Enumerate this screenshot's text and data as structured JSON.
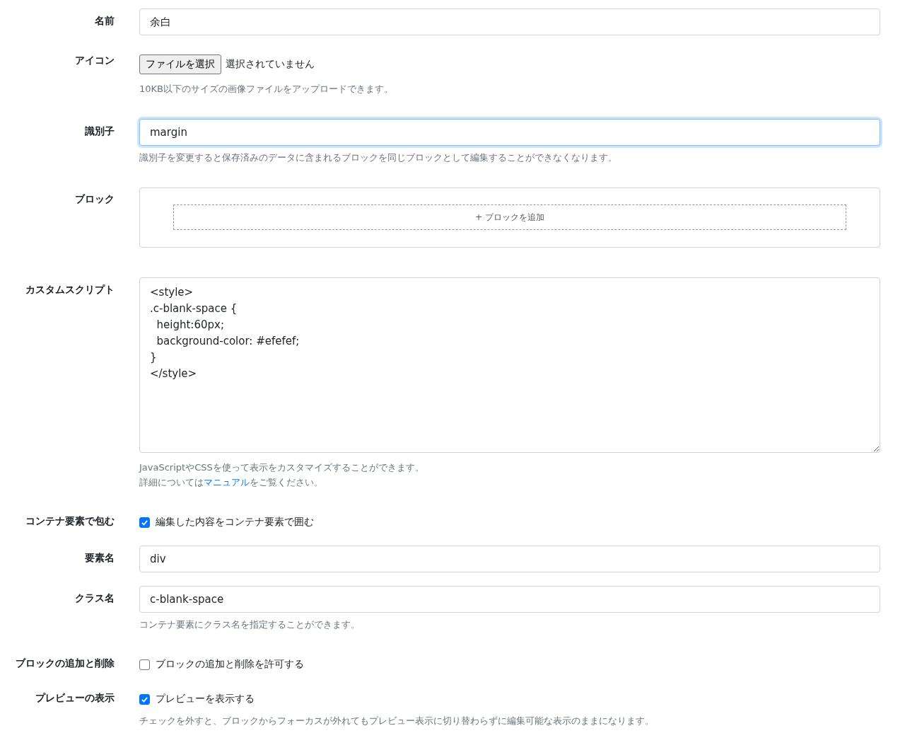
{
  "fields": [
    {
      "kind": "text",
      "label": "名前",
      "value": "余白",
      "focused": false
    },
    {
      "kind": "file",
      "label": "アイコン",
      "button": "ファイルを選択",
      "status": "選択されていません",
      "help": [
        {
          "text": "10KB以下のサイズの画像ファイルをアップロードできます。"
        }
      ]
    },
    {
      "kind": "text",
      "label": "識別子",
      "value": "margin",
      "focused": true,
      "help": [
        {
          "text": "識別子を変更すると保存済みのデータに含まれるブロックを同じブロックとして編集することができなくなります。"
        }
      ]
    },
    {
      "kind": "blocks",
      "label": "ブロック",
      "add": "+ ブロックを追加"
    },
    {
      "kind": "textarea",
      "label": "カスタムスクリプト",
      "value": "<style>\n.c-blank-space {\n  height:60px;\n  background-color: #efefef;\n}\n</style>",
      "help": [
        {
          "text": "JavaScriptやCSSを使って表示をカスタマイズすることができます。"
        },
        {
          "text": "詳細については",
          "link": "マニュアル",
          "after": "をご覧ください。"
        }
      ]
    },
    {
      "kind": "checkbox",
      "label": "コンテナ要素で包む",
      "text": "編集した内容をコンテナ要素で囲む",
      "checked": true
    },
    {
      "kind": "text",
      "label": "要素名",
      "value": "div",
      "focused": false
    },
    {
      "kind": "text",
      "label": "クラス名",
      "value": "c-blank-space",
      "focused": false,
      "help": [
        {
          "text": "コンテナ要素にクラス名を指定することができます。"
        }
      ]
    },
    {
      "kind": "checkbox",
      "label": "ブロックの追加と削除",
      "text": "ブロックの追加と削除を許可する",
      "checked": false
    },
    {
      "kind": "checkbox",
      "label": "プレビューの表示",
      "text": "プレビューを表示する",
      "checked": true,
      "help": [
        {
          "text": "チェックを外すと、ブロックからフォーカスが外れてもプレビュー表示に切り替わらずに編集可能な表示のままになります。"
        }
      ]
    }
  ]
}
